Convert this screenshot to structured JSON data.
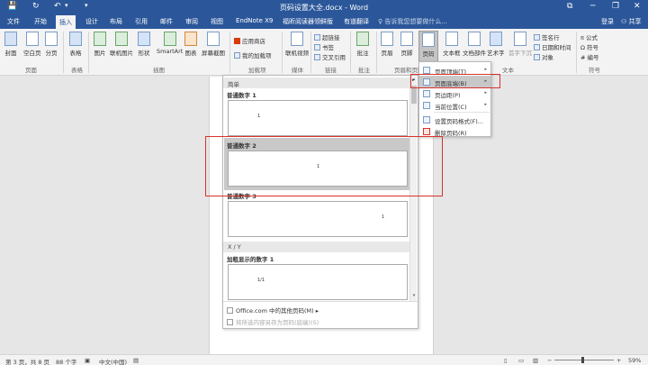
{
  "window": {
    "title": "页码设置大全.docx - Word",
    "minimize": "─",
    "restore": "❐",
    "close": "✕",
    "ribbon_options": "⧉"
  },
  "quick_access": {
    "save": "💾",
    "undo": "↶",
    "undo_dd": "▾",
    "redo": "↻",
    "customize": "▾"
  },
  "tabs": [
    {
      "label": "文件"
    },
    {
      "label": "开始"
    },
    {
      "label": "插入"
    },
    {
      "label": "设计"
    },
    {
      "label": "布局"
    },
    {
      "label": "引用"
    },
    {
      "label": "邮件"
    },
    {
      "label": "审阅"
    },
    {
      "label": "视图"
    },
    {
      "label": "EndNote X9"
    },
    {
      "label": "福昕阅读器领鲜版"
    },
    {
      "label": "有道翻译"
    }
  ],
  "tell_me": "♀ 告诉我您想要做什么...",
  "account": {
    "login": "登录",
    "share": "共享"
  },
  "ribbon": {
    "buttons": {
      "cover": "封面",
      "blank": "空白页",
      "pagebreak": "分页",
      "table": "表格",
      "picture": "图片",
      "online_picture": "联机图片",
      "shapes": "形状",
      "smartart": "SmartArt",
      "chart": "图表",
      "screenshot": "屏幕截图",
      "online_video": "联机视频",
      "comment": "批注",
      "header": "页眉",
      "footer": "页脚",
      "pagenum": "页码",
      "textbox": "文本框",
      "docparts": "文档部件",
      "wordart": "艺术字",
      "dropcap": "首字下沉"
    },
    "small": {
      "store": "应用商店",
      "myaddins": "我的加载项",
      "hyperlink": "超链接",
      "bookmark": "书签",
      "crossref": "交叉引用",
      "sigline": "签名行",
      "datetime": "日期和时间",
      "object": "对象",
      "equation": "公式",
      "symbol": "符号",
      "number": "编号"
    },
    "groups": {
      "pages": "页面",
      "tables": "表格",
      "illustrations": "插图",
      "addins": "加载项",
      "media": "媒体",
      "links": "链接",
      "comments": "批注",
      "headerfooter": "页眉和页脚",
      "text": "文本",
      "symbols": "符号"
    }
  },
  "gallery": {
    "section_simple": "简单",
    "items": [
      {
        "title": "普通数字 1",
        "pn": "1"
      },
      {
        "title": "普通数字 2",
        "pn": "1"
      },
      {
        "title": "普通数字 3",
        "pn": "1"
      }
    ],
    "section_xy": "X / Y",
    "item_bold": {
      "title": "加粗显示的数字 1",
      "pn": "1/1"
    },
    "more_office": "Office.com 中的其他页码(M)",
    "more_office_arrow": "▸",
    "save_selection": "将所选内容另存为页码(底端)(S)",
    "scroll_up": "▴",
    "scroll_down": "▾"
  },
  "context_menu": {
    "items": [
      {
        "label": "页面顶端(T)",
        "arrow": "▸"
      },
      {
        "label": "页面底端(B)",
        "arrow": "▸"
      },
      {
        "label": "页边距(P)",
        "arrow": "▸"
      },
      {
        "label": "当前位置(C)",
        "arrow": "▸"
      },
      {
        "label": "设置页码格式(F)...",
        "arrow": ""
      },
      {
        "label": "删除页码(R)",
        "arrow": ""
      }
    ],
    "marker": "▸"
  },
  "status": {
    "page": "第 3 页，共 8 页",
    "words": "88 个字",
    "lang": "中文(中国)",
    "zoom_minus": "−",
    "zoom_plus": "+",
    "zoom": "59%"
  },
  "colors": {
    "accent": "#2b579a",
    "highlight_box": "#d9322b"
  }
}
